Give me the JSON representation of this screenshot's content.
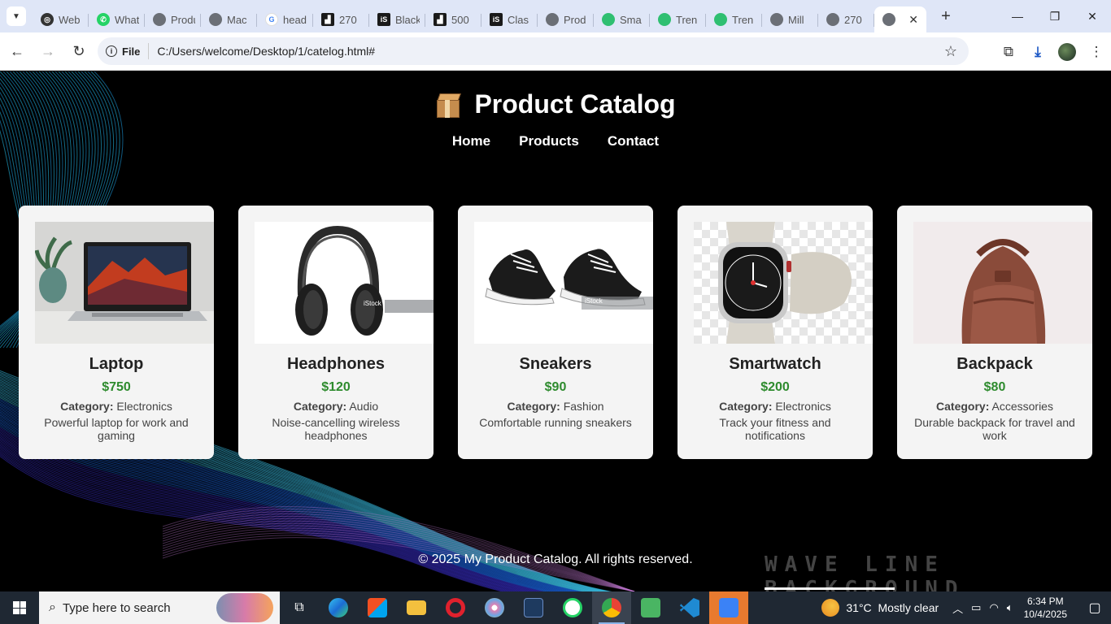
{
  "browser": {
    "tabs": [
      {
        "label": "Web",
        "fav": "openai"
      },
      {
        "label": "WhatsApp",
        "fav": "whatsapp"
      },
      {
        "label": "Product",
        "fav": "globe"
      },
      {
        "label": "Mac",
        "fav": "globe"
      },
      {
        "label": "head",
        "fav": "google"
      },
      {
        "label": "270",
        "fav": "istock"
      },
      {
        "label": "Black",
        "fav": "istock"
      },
      {
        "label": "500",
        "fav": "istock"
      },
      {
        "label": "Clas",
        "fav": "istock"
      },
      {
        "label": "Prod",
        "fav": "globe"
      },
      {
        "label": "Sma",
        "fav": "green"
      },
      {
        "label": "Tren",
        "fav": "green"
      },
      {
        "label": "Tren",
        "fav": "green"
      },
      {
        "label": "Mill",
        "fav": "globe"
      },
      {
        "label": "270",
        "fav": "globe"
      }
    ],
    "active_tab_close": "✕",
    "new_tab": "+",
    "site_chip": "File",
    "url": "C:/Users/welcome/Desktop/1/catelog.html#"
  },
  "page": {
    "title": "Product Catalog",
    "nav": [
      "Home",
      "Products",
      "Contact"
    ],
    "category_label": "Category:",
    "products": [
      {
        "name": "Laptop",
        "price": "$750",
        "category": "Electronics",
        "description": "Powerful laptop for work and gaming"
      },
      {
        "name": "Headphones",
        "price": "$120",
        "category": "Audio",
        "description": "Noise-cancelling wireless headphones"
      },
      {
        "name": "Sneakers",
        "price": "$90",
        "category": "Fashion",
        "description": "Comfortable running sneakers"
      },
      {
        "name": "Smartwatch",
        "price": "$200",
        "category": "Electronics",
        "description": "Track your fitness and notifications"
      },
      {
        "name": "Backpack",
        "price": "$80",
        "category": "Accessories",
        "description": "Durable backpack for travel and work"
      }
    ],
    "footer": "© 2025 My Product Catalog. All rights reserved.",
    "watermark": "WAVE LINE BACKGROUND",
    "istock_mark": "iStock"
  },
  "taskbar": {
    "search_placeholder": "Type here to search",
    "weather": "31°C",
    "weather_desc": "Mostly clear",
    "time": "6:34 PM",
    "date": "10/4/2025"
  },
  "colors": {
    "price": "#2e8b2e",
    "card_bg": "#f4f4f4",
    "page_bg": "#000000",
    "tabstrip_bg": "#dfe6f7"
  }
}
